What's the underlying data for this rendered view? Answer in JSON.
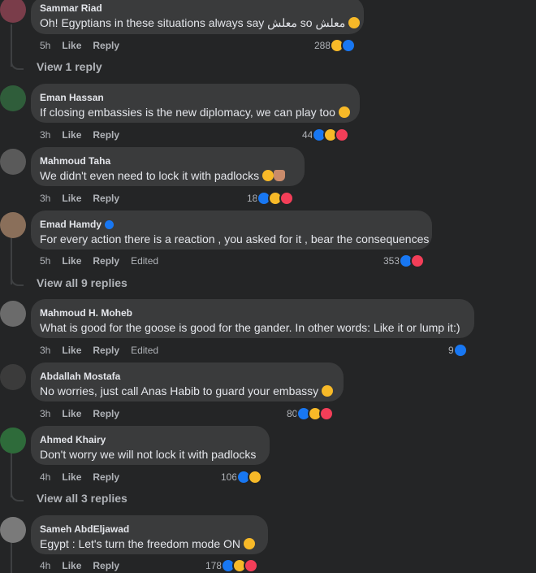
{
  "actions": {
    "like": "Like",
    "reply": "Reply",
    "edited": "Edited"
  },
  "comments": [
    {
      "author": "Sammar Riad",
      "text": "Oh! Egyptians in these situations always say معلش so معلش",
      "time": "5h",
      "count": "288",
      "reactions": [
        "haha",
        "like"
      ],
      "emoji": "haha",
      "verified": false,
      "edited": false
    },
    {
      "author": "Eman Hassan",
      "text": "If closing embassies is the new diplomacy, we can play too",
      "time": "3h",
      "count": "44",
      "reactions": [
        "like",
        "haha",
        "love"
      ],
      "emoji": "haha",
      "verified": false,
      "edited": false
    },
    {
      "author": "Mahmoud Taha",
      "text": "We didn't even need to lock it with padlocks",
      "time": "3h",
      "count": "18",
      "reactions": [
        "like",
        "haha",
        "love"
      ],
      "emoji": "rofl-person",
      "verified": false,
      "edited": false
    },
    {
      "author": "Emad Hamdy",
      "text": "For every action there is a reaction , you asked for it , bear the consequences",
      "time": "5h",
      "count": "353",
      "reactions": [
        "like",
        "love"
      ],
      "emoji": "",
      "verified": true,
      "edited": true
    },
    {
      "author": "Mahmoud H. Moheb",
      "text": "What is good for the goose is good for the gander. In other words: Like it or lump it:)",
      "time": "3h",
      "count": "9",
      "reactions": [
        "like"
      ],
      "emoji": "",
      "verified": false,
      "edited": true
    },
    {
      "author": "Abdallah Mostafa",
      "text": "No worries, just call Anas Habib to guard your embassy",
      "time": "3h",
      "count": "80",
      "reactions": [
        "like",
        "haha",
        "love"
      ],
      "emoji": "haha",
      "verified": false,
      "edited": false
    },
    {
      "author": "Ahmed Khairy",
      "text": "Don't worry we will not lock it with padlocks",
      "time": "4h",
      "count": "106",
      "reactions": [
        "like",
        "haha"
      ],
      "emoji": "",
      "verified": false,
      "edited": false
    },
    {
      "author": "Sameh AbdEljawad",
      "text": "Egypt : Let's turn the freedom mode ON",
      "time": "4h",
      "count": "178",
      "reactions": [
        "like",
        "haha",
        "love"
      ],
      "emoji": "haha",
      "verified": false,
      "edited": false
    }
  ],
  "replies": {
    "view_1": "View 1 reply",
    "view_9": "View all 9 replies",
    "view_3": "View all 3 replies"
  },
  "colors": {
    "like": "#1877f2",
    "haha": "#f7b928",
    "love": "#f33e58",
    "bubble": "#3a3b3c",
    "background": "#242526"
  }
}
